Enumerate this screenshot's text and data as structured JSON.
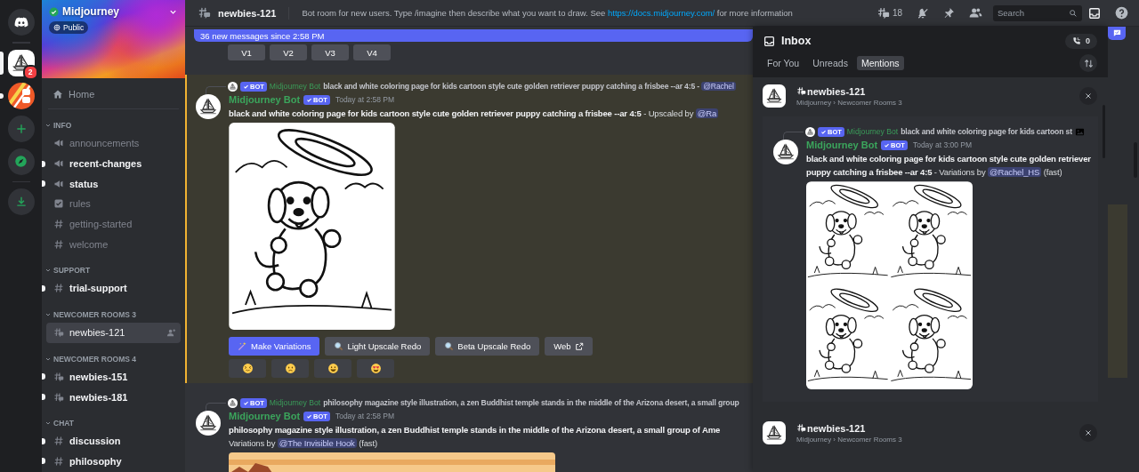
{
  "server_rail": {
    "servers": [
      {
        "kind": "sailboat",
        "selected": true,
        "unread": false,
        "badge": "2"
      },
      {
        "kind": "stripes",
        "selected": false,
        "unread": true
      }
    ]
  },
  "server": {
    "name": "Midjourney",
    "verified": true,
    "visibility": "Public"
  },
  "sidebar": {
    "home": "Home",
    "categories": [
      {
        "name": "INFO",
        "channels": [
          {
            "name": "announcements",
            "kind": "announcement",
            "unread": false,
            "selected": false
          },
          {
            "name": "recent-changes",
            "kind": "announcement",
            "unread": true,
            "selected": false
          },
          {
            "name": "status",
            "kind": "announcement",
            "unread": true,
            "selected": false
          },
          {
            "name": "rules",
            "kind": "rules",
            "unread": false,
            "selected": false
          },
          {
            "name": "getting-started",
            "kind": "text",
            "unread": false,
            "selected": false
          },
          {
            "name": "welcome",
            "kind": "text",
            "unread": false,
            "selected": false
          }
        ]
      },
      {
        "name": "SUPPORT",
        "channels": [
          {
            "name": "trial-support",
            "kind": "text",
            "unread": true,
            "selected": false
          }
        ]
      },
      {
        "name": "NEWCOMER ROOMS 3",
        "channels": [
          {
            "name": "newbies-121",
            "kind": "thread",
            "unread": false,
            "selected": true
          }
        ]
      },
      {
        "name": "NEWCOMER ROOMS 4",
        "channels": [
          {
            "name": "newbies-151",
            "kind": "thread",
            "unread": true,
            "selected": false
          },
          {
            "name": "newbies-181",
            "kind": "thread",
            "unread": true,
            "selected": false
          }
        ]
      },
      {
        "name": "CHAT",
        "channels": [
          {
            "name": "discussion",
            "kind": "text",
            "unread": true,
            "selected": false
          },
          {
            "name": "philosophy",
            "kind": "text",
            "unread": true,
            "selected": false
          }
        ]
      }
    ]
  },
  "header": {
    "channel": "newbies-121",
    "topic": {
      "before": "Bot room for new users. Type /imagine then describe what you want to draw. See ",
      "link": "https://docs.midjourney.com/",
      "after": " for more information"
    },
    "thread_count": "18",
    "search": {
      "placeholder": "Search"
    }
  },
  "chat": {
    "new_messages": "36 new messages since 2:58 PM",
    "top_buttons": [
      "V1",
      "V2",
      "V3",
      "V4"
    ],
    "messages": [
      {
        "highlighted": true,
        "reply": {
          "author": "Midjourney Bot",
          "tag": "BOT",
          "text": "black and white coloring page for kids cartoon style cute golden retriever puppy catching a frisbee --ar 4:5 - ",
          "mention": "@Rachel"
        },
        "author": "Midjourney Bot",
        "tag": "BOT",
        "time": "Today at 2:58 PM",
        "lines": [
          [
            {
              "bold": "black and white coloring page for kids cartoon style cute golden retriever puppy catching a frisbee --ar 4:5"
            },
            {
              "text": " - Upscaled by "
            },
            {
              "mention": "@Ra"
            }
          ]
        ],
        "image": {
          "kind": "puppy"
        },
        "buttons": [
          {
            "label": "Make Variations",
            "kind": "variations"
          },
          {
            "label": "Light Upscale Redo",
            "kind": "upscale"
          },
          {
            "label": "Beta Upscale Redo",
            "kind": "upscale"
          },
          {
            "label": "Web",
            "kind": "link"
          }
        ],
        "reactions": [
          {
            "kind": "persevere"
          },
          {
            "kind": "frown"
          },
          {
            "kind": "grin"
          },
          {
            "kind": "heart_eyes"
          }
        ]
      },
      {
        "highlighted": false,
        "reply": {
          "author": "Midjourney Bot",
          "tag": "BOT",
          "text": "philosophy magazine style illustration, a zen Buddhist temple stands in the middle of the Arizona desert, a small group"
        },
        "author": "Midjourney Bot",
        "tag": "BOT",
        "time": "Today at 2:58 PM",
        "lines": [
          [
            {
              "bold": "philosophy magazine style illustration, a zen Buddhist temple stands in the middle of the Arizona desert, a small group of Ame"
            }
          ],
          [
            {
              "text": "Variations by "
            },
            {
              "mention": "@The Invisible Hook"
            },
            {
              "text": " (fast)"
            }
          ]
        ],
        "image": {
          "kind": "desert"
        }
      }
    ]
  },
  "inbox": {
    "title": "Inbox",
    "call_count": "0",
    "tabs": [
      {
        "label": "For You",
        "selected": false
      },
      {
        "label": "Unreads",
        "selected": false
      },
      {
        "label": "Mentions",
        "selected": true
      }
    ],
    "groups": [
      {
        "channel": "newbies-121",
        "path": "Midjourney › Newcomer Rooms 3",
        "messages": [
          {
            "highlighted": false,
            "reply": {
              "author": "Midjourney Bot",
              "tag": "BOT",
              "text": "black and white coloring page for kids cartoon st",
              "attachment": true
            },
            "author": "Midjourney Bot",
            "tag": "BOT",
            "time": "Today at 3:00 PM",
            "lines": [
              [
                {
                  "bold": "black and white coloring page for kids cartoon style cute golden retriever puppy catching a frisbee --ar 4:5"
                },
                {
                  "text": " - Variations by "
                },
                {
                  "mention": "@Rachel_HS"
                },
                {
                  "text": " (fast)"
                }
              ]
            ],
            "image": {
              "kind": "puppy_grid"
            }
          }
        ]
      },
      {
        "channel": "newbies-121",
        "path": "Midjourney › Newcomer Rooms 3"
      }
    ]
  }
}
